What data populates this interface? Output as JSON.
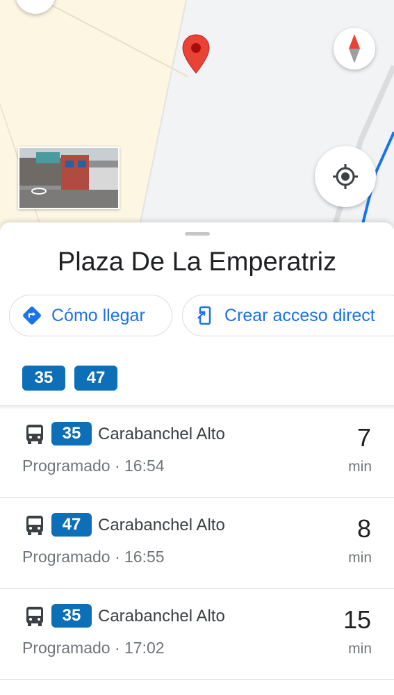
{
  "place_title": "Plaza De La Emperatriz",
  "actions": {
    "directions_label": "Cómo llegar",
    "shortcut_label": "Crear acceso direct"
  },
  "lines": [
    "35",
    "47"
  ],
  "departures": [
    {
      "line": "35",
      "destination": "Carabanchel Alto",
      "status": "Programado · 16:54",
      "minutes": "7",
      "unit": "min"
    },
    {
      "line": "47",
      "destination": "Carabanchel Alto",
      "status": "Programado · 16:55",
      "minutes": "8",
      "unit": "min"
    },
    {
      "line": "35",
      "destination": "Carabanchel Alto",
      "status": "Programado · 17:02",
      "minutes": "15",
      "unit": "min"
    }
  ],
  "colors": {
    "line_badge": "#0d6fb8",
    "accent": "#1a73e8",
    "pin": "#ea4335",
    "transit_line": "#1a73e8"
  },
  "icons": {
    "pin": "map-pin-icon",
    "compass": "compass-icon",
    "location": "my-location-icon",
    "directions": "directions-icon",
    "shortcut": "add-shortcut-icon",
    "bus": "bus-icon"
  }
}
